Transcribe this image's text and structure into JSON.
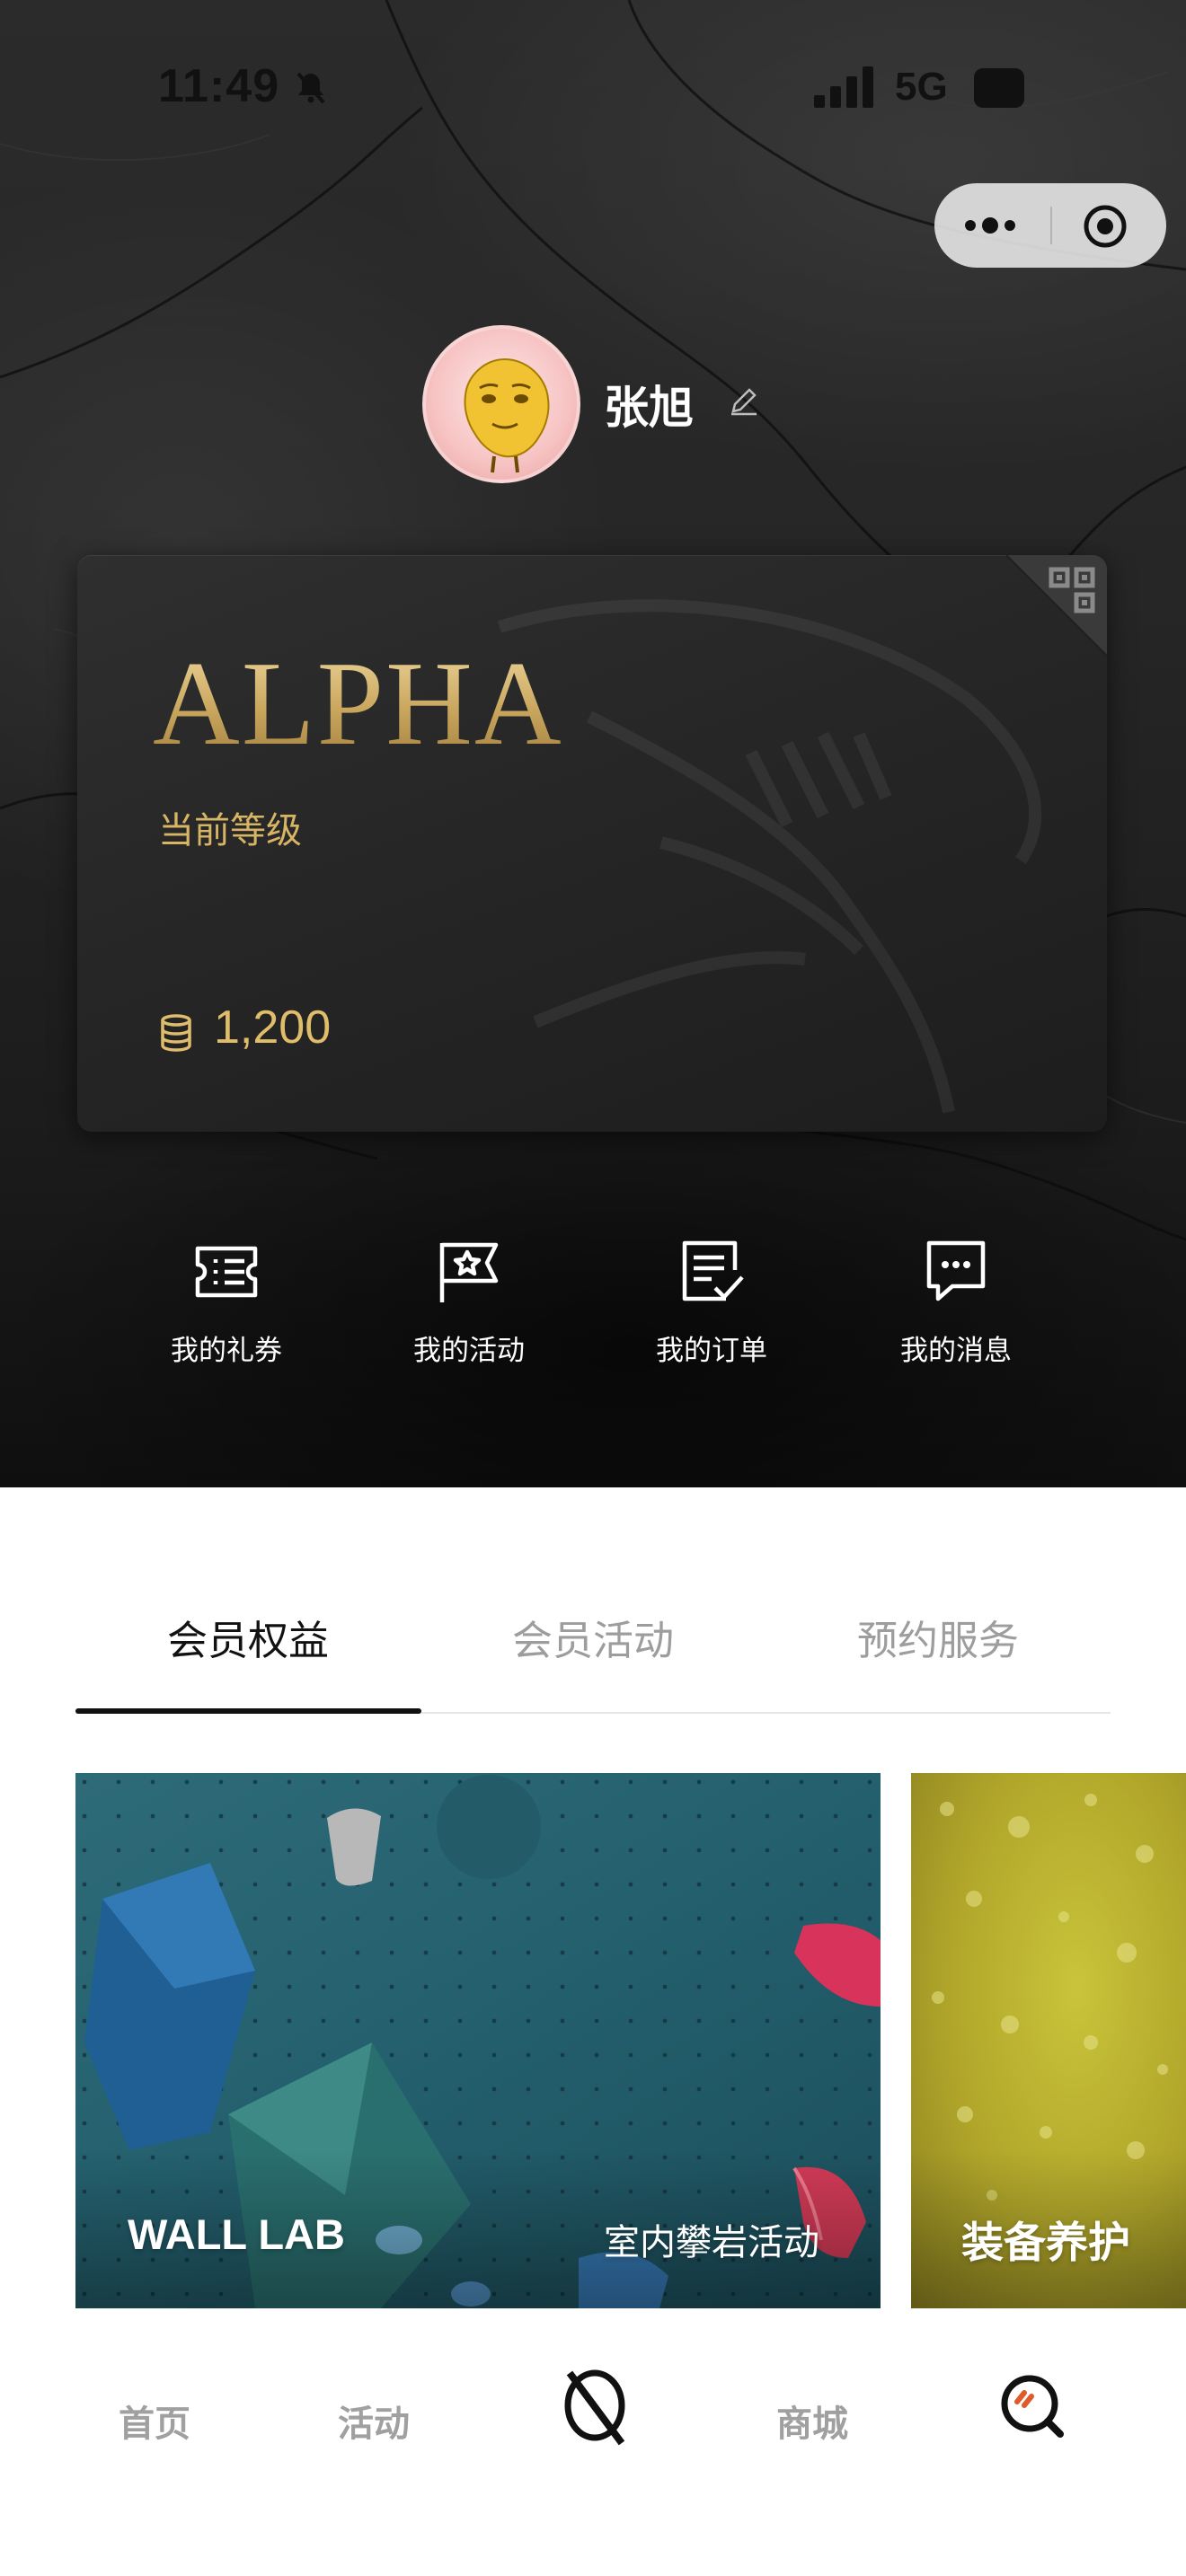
{
  "status_bar": {
    "time": "11:49",
    "network": "5G"
  },
  "profile": {
    "username": "张旭"
  },
  "member_card": {
    "tier": "ALPHA",
    "level_label": "当前等级",
    "points": "1,200"
  },
  "quick_actions": [
    {
      "label": "我的礼券",
      "icon": "coupon-icon"
    },
    {
      "label": "我的活动",
      "icon": "flag-star-icon"
    },
    {
      "label": "我的订单",
      "icon": "order-icon"
    },
    {
      "label": "我的消息",
      "icon": "message-icon"
    }
  ],
  "tabs": [
    {
      "label": "会员权益",
      "active": true
    },
    {
      "label": "会员活动",
      "active": false
    },
    {
      "label": "预约服务",
      "active": false
    }
  ],
  "benefit_cards": [
    {
      "brand": "WALL LAB",
      "title": "室内攀岩活动"
    },
    {
      "title": "装备养护"
    }
  ],
  "bottom_nav": [
    {
      "label": "首页"
    },
    {
      "label": "活动"
    },
    {
      "icon": "brand-logo-icon"
    },
    {
      "label": "商城"
    },
    {
      "icon": "profile-logo-icon"
    }
  ],
  "colors": {
    "gold": "#d8b465",
    "dark": "#1f1f1f",
    "tab_inactive": "#9d9d9d"
  }
}
